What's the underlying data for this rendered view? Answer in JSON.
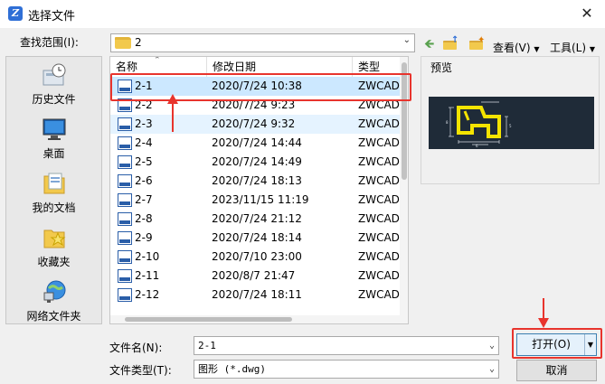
{
  "window": {
    "title": "选择文件",
    "app_icon_glyph": "Z"
  },
  "toolbar": {
    "look_in_label": "查找范围(I):",
    "look_in_value": "2",
    "view_label": "查看(V)",
    "tools_label": "工具(L)",
    "icons": [
      "back-icon",
      "up-folder-icon",
      "new-folder-icon"
    ]
  },
  "places": [
    {
      "label": "历史文件",
      "icon": "history-icon"
    },
    {
      "label": "桌面",
      "icon": "desktop-icon"
    },
    {
      "label": "我的文档",
      "icon": "documents-icon"
    },
    {
      "label": "收藏夹",
      "icon": "favorites-icon"
    },
    {
      "label": "网络文件夹",
      "icon": "network-icon"
    }
  ],
  "filelist": {
    "columns": {
      "name": "名称",
      "date": "修改日期",
      "type": "类型"
    },
    "rows": [
      {
        "name": "2-1",
        "date": "2020/7/24 10:38",
        "type": "ZWCAD",
        "selected": true
      },
      {
        "name": "2-2",
        "date": "2020/7/24 9:23",
        "type": "ZWCAD"
      },
      {
        "name": "2-3",
        "date": "2020/7/24 9:32",
        "type": "ZWCAD"
      },
      {
        "name": "2-4",
        "date": "2020/7/24 14:44",
        "type": "ZWCAD"
      },
      {
        "name": "2-5",
        "date": "2020/7/24 14:49",
        "type": "ZWCAD"
      },
      {
        "name": "2-6",
        "date": "2020/7/24 18:13",
        "type": "ZWCAD"
      },
      {
        "name": "2-7",
        "date": "2023/11/15 11:19",
        "type": "ZWCAD"
      },
      {
        "name": "2-8",
        "date": "2020/7/24 21:12",
        "type": "ZWCAD"
      },
      {
        "name": "2-9",
        "date": "2020/7/24 18:14",
        "type": "ZWCAD"
      },
      {
        "name": "2-10",
        "date": "2020/7/10 23:00",
        "type": "ZWCAD"
      },
      {
        "name": "2-11",
        "date": "2020/8/7 21:47",
        "type": "ZWCAD"
      },
      {
        "name": "2-12",
        "date": "2020/7/24 18:11",
        "type": "ZWCAD"
      }
    ]
  },
  "preview": {
    "label": "预览"
  },
  "bottom": {
    "file_name_label": "文件名(N):",
    "file_name_value": "2-1",
    "file_type_label": "文件类型(T):",
    "file_type_value": "图形 (*.dwg)",
    "open_label": "打开(O)",
    "cancel_label": "取消"
  },
  "colors": {
    "highlight": "#e8342d",
    "selection": "#cce8ff",
    "accent": "#3c7fb1"
  }
}
